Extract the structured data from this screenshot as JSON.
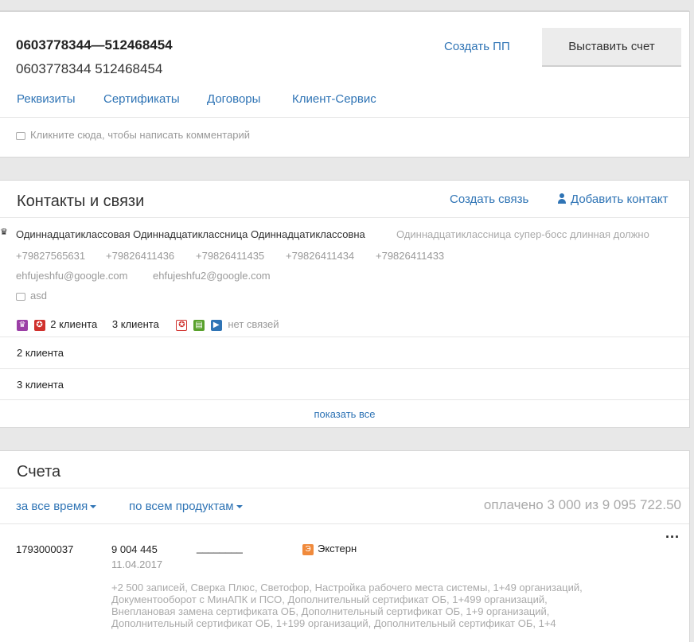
{
  "header": {
    "account_title": "0603778344—512468454",
    "account_subtitle": "0603778344 512468454",
    "create_pp": "Создать ПП",
    "issue_invoice": "Выставить счет",
    "tabs": [
      "Реквизиты",
      "Сертификаты",
      "Договоры",
      "Клиент-Сервис"
    ],
    "comment_placeholder": "Кликните сюда, чтобы написать комментарий"
  },
  "contacts": {
    "title": "Контакты и связи",
    "create_link": "Создать связь",
    "add_contact": "Добавить контакт",
    "contact": {
      "name": "Одиннадцатиклассовая Одиннадцатиклассница Одиннадцатиклассовна",
      "position": "Одиннадцатиклассница супер-босс длинная должно",
      "phones": [
        "+79827565631",
        "+79826411436",
        "+79826411435",
        "+79826411434",
        "+79826411433"
      ],
      "emails": [
        "ehfujeshfu@google.com",
        "ehfujeshfu2@google.com"
      ],
      "comment": "asd"
    },
    "relations": {
      "clients_a": "2 клиента",
      "clients_b": "3 клиента",
      "no_links": "нет связей"
    },
    "rows": [
      "2 клиента",
      "3 клиента"
    ],
    "show_all": "показать все"
  },
  "invoices": {
    "title": "Счета",
    "filter_period": "за все время",
    "filter_product": "по всем продуктам",
    "paid_summary": "оплачено 3 000 из 9 095 722.50",
    "items": [
      {
        "number": "1793000037",
        "amount": "9 004 445",
        "date": "11.04.2017",
        "status": "________",
        "product": "Экстерн",
        "more": "···",
        "description_lines": [
          "+2 500 записей, Сверка Плюс, Светофор, Настройка рабочего места системы, 1+49 организаций,",
          "Документооборот с МинАПК и ПСО, Дополнительный сертификат ОБ, 1+499 организаций,",
          "Внеплановая замена сертификата ОБ, Дополнительный сертификат ОБ, 1+9 организаций,",
          "Дополнительный сертификат ОБ, 1+199 организаций, Дополнительный сертификат ОБ, 1+4"
        ]
      }
    ]
  },
  "colors": {
    "link": "#2f74b5",
    "crown_badge": "#9b3fa6",
    "red_badge": "#d0312d",
    "green_badge": "#59a12c",
    "blue_badge": "#2f74b5",
    "extern_badge": "#f08a3c"
  }
}
